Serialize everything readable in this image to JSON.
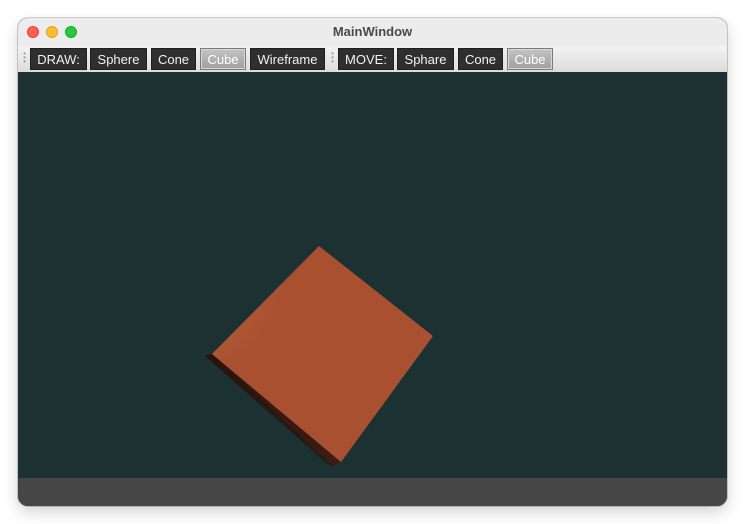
{
  "window": {
    "title": "MainWindow"
  },
  "toolbar": {
    "draw_label": "DRAW:",
    "draw_sphere": "Sphere",
    "draw_cone": "Cone",
    "draw_cube": "Cube",
    "draw_wireframe": "Wireframe",
    "move_label": "MOVE:",
    "move_sphere": "Sphare",
    "move_cone": "Cone",
    "move_cube": "Cube",
    "checked": [
      "draw_cube",
      "move_cube"
    ]
  },
  "scene": {
    "background_color": "#1c3232",
    "object": "cube",
    "object_color": "#b4583a",
    "highlight_color": "#ffd2b8"
  },
  "colors": {
    "toolbar_button": "#2f2f2f",
    "toolbar_button_checked": "#b0b0b0",
    "statusbar": "#464646"
  }
}
